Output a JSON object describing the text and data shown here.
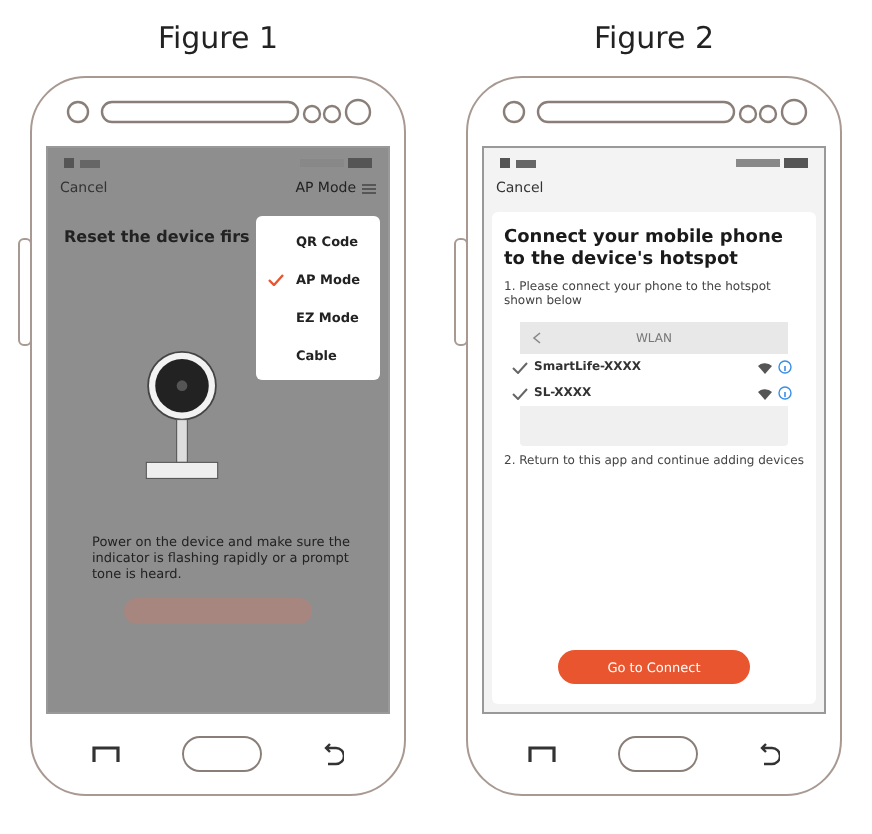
{
  "figures": [
    {
      "caption": "Figure 1",
      "kind": "mode_menu",
      "dimmed": true,
      "screen": {
        "cancel": "Cancel",
        "mode": "AP Mode",
        "title": "Reset the device firs",
        "instruction": "Power on the device and make sure the indicator is flashing rapidly or a prompt tone is heard.",
        "menu": [
          {
            "label": "QR Code",
            "selected": false
          },
          {
            "label": "AP Mode",
            "selected": true
          },
          {
            "label": "EZ Mode",
            "selected": false
          },
          {
            "label": "Cable",
            "selected": false
          }
        ]
      }
    },
    {
      "caption": "Figure 2",
      "kind": "hotspot",
      "dimmed": false,
      "screen": {
        "cancel": "Cancel",
        "title": "Connect your mobile phone to the device's hotspot",
        "step_1": "1. Please connect your phone to the hotspot shown below",
        "wlan": "WLAN",
        "networks": [
          {
            "name": "SmartLife-XXXX"
          },
          {
            "name": "SL-XXXX"
          }
        ],
        "step_2": "2. Return to this app and continue adding devices",
        "button": "Go to Connect"
      }
    }
  ]
}
